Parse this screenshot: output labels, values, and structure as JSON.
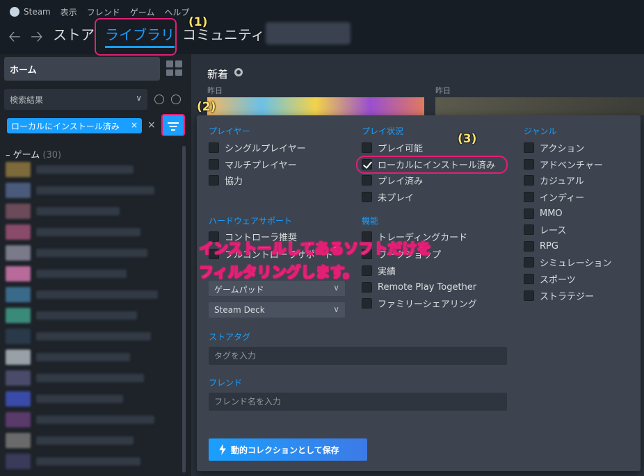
{
  "menubar": {
    "app": "Steam",
    "items": [
      "表示",
      "フレンド",
      "ゲーム",
      "ヘルプ"
    ]
  },
  "nav": {
    "tabs": [
      {
        "label": "ストア"
      },
      {
        "label": "ライブラリ",
        "active": true
      },
      {
        "label": "コミュニティ"
      }
    ]
  },
  "sidebar": {
    "home_label": "ホーム",
    "search_select": "検索結果",
    "active_filter": "ローカルにインストール済み",
    "games_label": "ゲーム",
    "games_count": "(30)"
  },
  "main": {
    "section_title": "新着",
    "yesterday_left": "昨日",
    "yesterday_right": "昨日"
  },
  "panel": {
    "player": {
      "title": "プレイヤー",
      "options": [
        "シングルプレイヤー",
        "マルチプレイヤー",
        "協力"
      ]
    },
    "play_state": {
      "title": "プレイ状況",
      "options": [
        "プレイ可能",
        "ローカルにインストール済み",
        "プレイ済み",
        "未プレイ"
      ],
      "checked_index": 1
    },
    "genre": {
      "title": "ジャンル",
      "options": [
        "アクション",
        "アドベンチャー",
        "カジュアル",
        "インディー",
        "MMO",
        "レース",
        "RPG",
        "シミュレーション",
        "スポーツ",
        "ストラテジー"
      ]
    },
    "hardware": {
      "title": "ハードウェアサポート",
      "options": [
        "コントローラ推奨",
        "フルコントローラサポート"
      ],
      "dropdown_gamepad": "ゲームパッド",
      "dropdown_deck": "Steam Deck"
    },
    "features": {
      "title": "機能",
      "options": [
        "トレーディングカード",
        "ワークショップ",
        "実績",
        "Remote Play Together",
        "ファミリーシェアリング"
      ]
    },
    "store_tags": {
      "title": "ストアタグ",
      "placeholder": "タグを入力"
    },
    "friends": {
      "title": "フレンド",
      "placeholder": "フレンド名を入力"
    },
    "save_label": "動的コレクションとして保存"
  },
  "annotations": {
    "n1": "(1)",
    "n2": "(2)",
    "n3": "(3)",
    "callout_line1": "インストールしてあるソフトだけを",
    "callout_line2": "フィルタリングします。"
  },
  "colors": {
    "accent": "#1a9fff",
    "annotation": "#e31f75",
    "label": "#ffe36b"
  }
}
